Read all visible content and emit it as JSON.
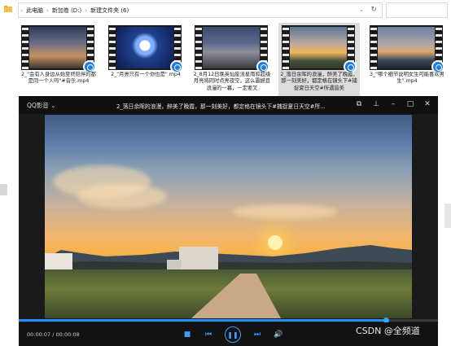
{
  "explorer": {
    "breadcrumb": [
      "此电脑",
      "新加卷 (D:)",
      "新建文件夹 (6)"
    ],
    "files": [
      {
        "name": "2_\"会有人身边从始至终陪伴的都是同一个人吗\"#音乐.mp4",
        "selected": false
      },
      {
        "name": "2_\"月亮只有一个你也是\".mp4",
        "selected": false
      },
      {
        "name": "2_8月12日晚英仙座流星雨和超级月亮将同时点亮夜空，这么震撼且浪漫的一幕，一定要叉",
        "selected": false
      },
      {
        "name": "2_落日余晖的浪漫，醉美了晚霞，那一刻美好，都定格在镜头下#捕捉夏日天空#所遇皆美",
        "selected": true
      },
      {
        "name": "3_\"哪个细节说明女生可能喜欢男生\".mp4",
        "selected": false
      }
    ]
  },
  "player": {
    "brand": "QQ影音",
    "title": "2_落日余晖的浪漫，醉美了晚霞，那一刻美好，都定格在镜头下#捕捉夏日天空#所...",
    "time_current": "00:00:07",
    "time_total": "00:00:08",
    "progress": 0.875,
    "accent": "#1e90ff"
  },
  "watermark": "CSDN @全频道"
}
